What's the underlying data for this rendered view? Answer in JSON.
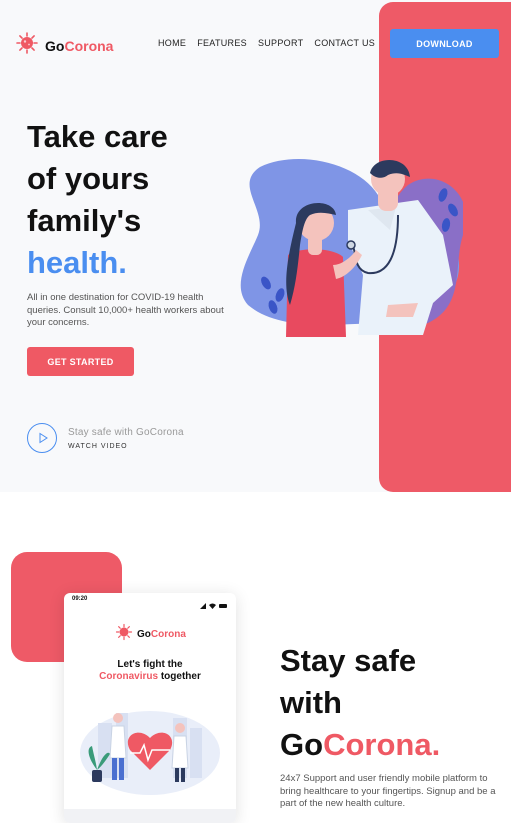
{
  "header": {
    "brand_go": "Go",
    "brand_corona": "Corona",
    "nav": [
      "HOME",
      "FEATURES",
      "SUPPORT",
      "CONTACT US"
    ],
    "download_label": "DOWNLOAD"
  },
  "hero": {
    "title_line1": "Take care",
    "title_line2": "of yours",
    "title_line3": "family's",
    "title_highlight": "health.",
    "description": "All in one destination for COVID-19 health queries. Consult 10,000+ health workers about your concerns.",
    "cta_label": "GET STARTED",
    "video_title": "Stay safe with GoCorona",
    "video_label": "WATCH VIDEO"
  },
  "phone": {
    "status_time": "09:20",
    "brand_go": "Go",
    "brand_corona": "Corona",
    "title_line1": "Let's fight the",
    "title_red": "Coronavirus",
    "title_rest": " together"
  },
  "section2": {
    "title_line1": "Stay safe",
    "title_line2": "with",
    "title_go": "Go",
    "title_corona": "Corona.",
    "description": "24x7 Support and user friendly mobile platform to bring healthcare to your fingertips. Signup and be a part of the new health culture."
  },
  "colors": {
    "accent_red": "#ef5964",
    "accent_blue": "#4a8ef0",
    "hero_bg": "#f8f9fb"
  },
  "icons": [
    "virus-logo-icon",
    "play-icon",
    "signal-icon",
    "wifi-icon",
    "battery-icon"
  ]
}
